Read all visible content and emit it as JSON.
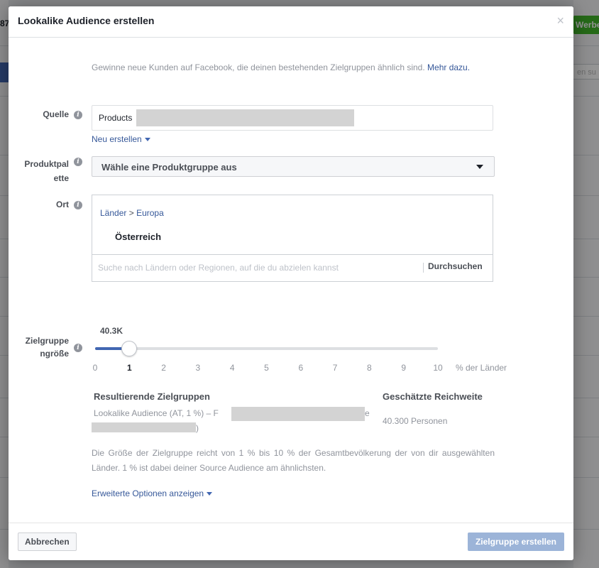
{
  "dialog": {
    "title": "Lookalike Audience erstellen",
    "close_symbol": "×",
    "intro_text": "Gewinne neue Kunden auf Facebook, die deinen bestehenden Zielgruppen ähnlich sind.",
    "intro_link": "Mehr dazu."
  },
  "source": {
    "label": "Quelle",
    "value_prefix": "Products",
    "new_create": "Neu erstellen"
  },
  "catalog": {
    "label_line1": "Produktpal",
    "label_line2": "ette",
    "placeholder": "Wähle eine Produktgruppe aus"
  },
  "location": {
    "label": "Ort",
    "crumb_parent": "Länder",
    "crumb_sep": ">",
    "crumb_child": "Europa",
    "selected_country": "Österreich",
    "search_placeholder": "Suche nach Ländern oder Regionen, auf die du abzielen kannst",
    "search_button": "Durchsuchen"
  },
  "audience_size": {
    "label_line1": "Zielgruppe",
    "label_line2": "ngröße",
    "estimated": "40.3K",
    "selected_percent": 1,
    "ticks": [
      "0",
      "1",
      "2",
      "3",
      "4",
      "5",
      "6",
      "7",
      "8",
      "9",
      "10"
    ],
    "unit": "% der Länder"
  },
  "results": {
    "header_left": "Resultierende Zielgruppen",
    "header_right": "Geschätzte Reichweite",
    "audience_prefix": "Lookalike Audience (AT, 1 %) – F",
    "audience_tail_1": "e",
    "audience_tail_2": ")",
    "reach_value": "40.300 Personen"
  },
  "size_note": "Die Größe der Zielgruppe reicht von 1 % bis 10 % der Gesamtbevölkerung der von dir ausgewählten Länder. 1 % ist dabei deiner Source Audience am ähnlichsten.",
  "advanced_options": "Erweiterte Optionen anzeigen",
  "footer": {
    "cancel": "Abbrechen",
    "create": "Zielgruppe erstellen"
  },
  "background": {
    "button_partial": "Werbe",
    "search_partial": "en su",
    "header_partial": "87"
  },
  "colors": {
    "link": "#365899",
    "slider_fill": "#4267b2",
    "create_button_disabled": "#9cb4d8"
  },
  "icons": {
    "info": "i",
    "dropdown": "caret-down-icon"
  }
}
